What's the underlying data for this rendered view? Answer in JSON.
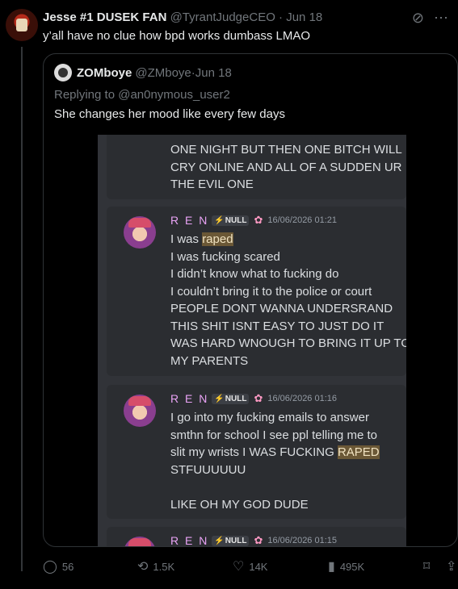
{
  "tweet": {
    "display_name": "Jesse #1 DUSEK FAN",
    "handle": "@TyrantJudgeCEO",
    "sep": " · ",
    "date": "Jun 18",
    "text": "y’all have no clue how bpd works dumbass LMAO"
  },
  "quote": {
    "display_name": "ZOMboye",
    "handle": "@ZMboye",
    "sep": " · ",
    "date": "Jun 18",
    "replying_to": "Replying to @an0nymous_user2",
    "text": "She changes her mood like every few days"
  },
  "screenshot": {
    "msg0_lines": [
      "ONE NIGHT BUT THEN ONE BITCH WILL",
      "CRY ONLINE AND ALL OF A SUDDEN UR",
      "THE EVIL ONE"
    ],
    "username": "R E N",
    "badge": "NULL",
    "msg1": {
      "timestamp": "16/06/2026 01:21",
      "l0_pre": "I was ",
      "l0_hl": "raped",
      "lines": [
        "I was fucking scared",
        "I didn’t know what to fucking do",
        "I couldn’t bring it to the police or court",
        "PEOPLE DONT WANNA UNDERSRAND",
        "THIS SHIT ISNT EASY TO JUST DO IT",
        "WAS HARD WNOUGH TO BRING IT UP TO",
        "MY PARENTS"
      ]
    },
    "msg2": {
      "timestamp": "16/06/2026 01:16",
      "l0": "I go into my fucking emails to answer",
      "l1": "smthn for school I see ppl telling me to",
      "l2_pre": "slit my wrists I WAS FUCKING ",
      "l2_hl": "RAPED",
      "l3": "STFUUUUUU",
      "l4": "LIKE OH MY GOD DUDE"
    },
    "msg3": {
      "timestamp": "16/06/2026 01:15"
    }
  },
  "actions": {
    "replies": "56",
    "reposts": "1.5K",
    "likes": "14K",
    "views": "495K"
  },
  "icons": [
    "grok-icon",
    "more-icon",
    "reply-icon",
    "repost-icon",
    "like-icon",
    "views-icon",
    "bookmark-icon",
    "share-icon",
    "lightning-icon",
    "flower-icon"
  ]
}
